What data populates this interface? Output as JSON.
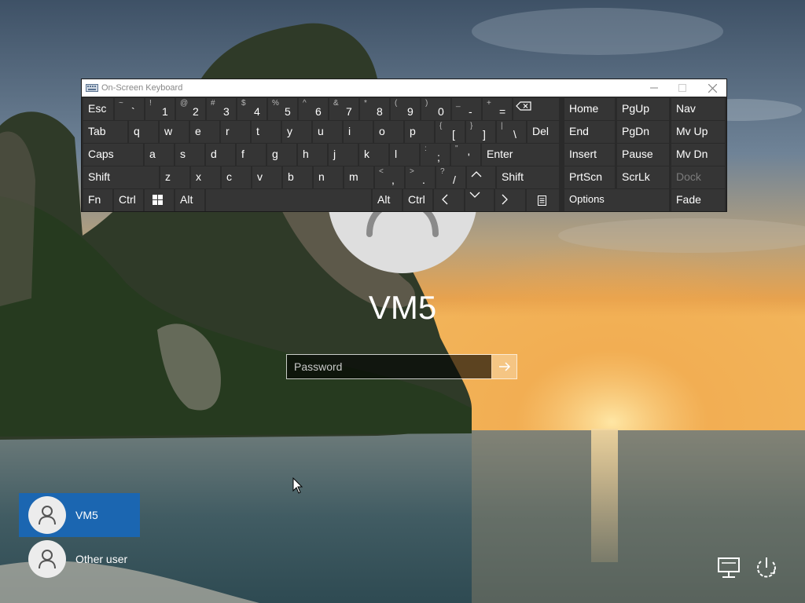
{
  "login": {
    "username": "VM5",
    "password_placeholder": "Password"
  },
  "users": [
    {
      "name": "VM5",
      "selected": true
    },
    {
      "name": "Other user",
      "selected": false
    }
  ],
  "osk": {
    "title": "On-Screen Keyboard",
    "keys": {
      "esc": "Esc",
      "tilde_shift": "~",
      "tilde_base": "`",
      "k1_shift": "!",
      "k1_base": "1",
      "k2_shift": "@",
      "k2_base": "2",
      "k3_shift": "#",
      "k3_base": "3",
      "k4_shift": "$",
      "k4_base": "4",
      "k5_shift": "%",
      "k5_base": "5",
      "k6_shift": "^",
      "k6_base": "6",
      "k7_shift": "&",
      "k7_base": "7",
      "k8_shift": "*",
      "k8_base": "8",
      "k9_shift": "(",
      "k9_base": "9",
      "k0_shift": ")",
      "k0_base": "0",
      "minus_shift": "_",
      "minus_base": "-",
      "plus_shift": "+",
      "plus_base": "=",
      "tab": "Tab",
      "q": "q",
      "w": "w",
      "e": "e",
      "r": "r",
      "t": "t",
      "y": "y",
      "u": "u",
      "i": "i",
      "o": "o",
      "p": "p",
      "lbracket_shift": "{",
      "lbracket_base": "[",
      "rbracket_shift": "}",
      "rbracket_base": "]",
      "backslash_shift": "|",
      "backslash_base": "\\",
      "del": "Del",
      "caps": "Caps",
      "a": "a",
      "s": "s",
      "d": "d",
      "f": "f",
      "g": "g",
      "h": "h",
      "j": "j",
      "k": "k",
      "l": "l",
      "semicolon_shift": ":",
      "semicolon_base": ";",
      "quote_shift": "\"",
      "quote_base": "'",
      "enter": "Enter",
      "shift": "Shift",
      "z": "z",
      "x": "x",
      "c": "c",
      "v": "v",
      "b": "b",
      "n": "n",
      "m": "m",
      "comma_shift": "<",
      "comma_base": ",",
      "period_shift": ">",
      "period_base": ".",
      "slash_shift": "?",
      "slash_base": "/",
      "up": "^",
      "fn": "Fn",
      "ctrl": "Ctrl",
      "alt": "Alt",
      "down": "v",
      "home": "Home",
      "pgup": "PgUp",
      "nav": "Nav",
      "end": "End",
      "pgdn": "PgDn",
      "mvup": "Mv Up",
      "insert": "Insert",
      "pause": "Pause",
      "mvdn": "Mv Dn",
      "prtscn": "PrtScn",
      "scrlk": "ScrLk",
      "dock": "Dock",
      "options": "Options",
      "fade": "Fade"
    }
  },
  "icons": {
    "network": "network-icon",
    "power": "power-icon",
    "submit": "arrow-right-icon",
    "user": "user-icon",
    "keyboard": "keyboard-icon",
    "backspace": "backspace-icon",
    "windows": "windows-logo-icon",
    "menu": "context-menu-icon"
  },
  "colors": {
    "selected_user": "#1b66b1",
    "key_bg": "#353535",
    "osk_bg": "#2a2a2a"
  }
}
